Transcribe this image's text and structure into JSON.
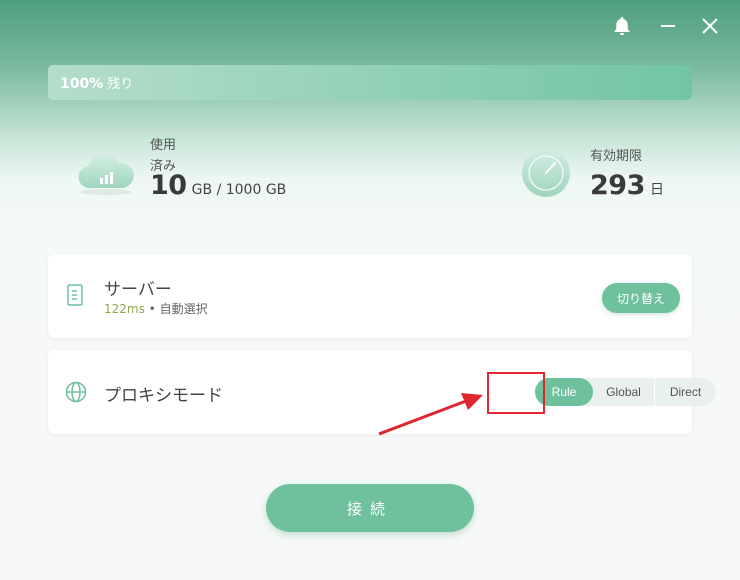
{
  "titlebar": {
    "bell_icon": "bell-icon",
    "minimize_icon": "minimize-icon",
    "close_icon": "close-icon"
  },
  "quota": {
    "percent_label": "100%",
    "remaining_label": "残り",
    "fraction": 1.0
  },
  "usage": {
    "label_line1": "使用",
    "label_line2": "済み",
    "used": "10",
    "unit": "GB / 1000 GB"
  },
  "validity": {
    "label": "有効期限",
    "days": "293",
    "unit": "日"
  },
  "server": {
    "title": "サーバー",
    "latency": "122ms",
    "separator": " • ",
    "mode": "自動選択",
    "switch_label": "切り替え"
  },
  "proxy": {
    "title": "プロキシモード",
    "options": [
      "Rule",
      "Global",
      "Direct"
    ],
    "selected": "Rule"
  },
  "connect": {
    "label": "接続"
  },
  "colors": {
    "accent": "#6fc19d",
    "highlight": "#e0262e"
  }
}
